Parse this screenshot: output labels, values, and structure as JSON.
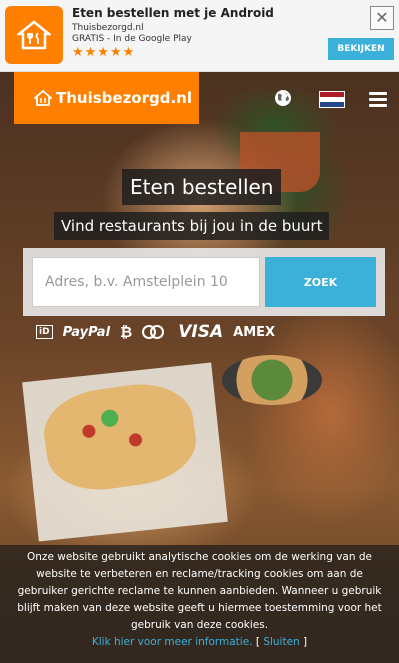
{
  "app_banner": {
    "title": "Eten bestellen met je Android",
    "developer": "Thuisbezorgd.nl",
    "store_info": "GRATIS - In de Google Play",
    "stars": "★★★★★",
    "rating": 5,
    "close_symbol": "✕",
    "view_label": "BEKIJKEN",
    "icon": "fork-knife-icon"
  },
  "header": {
    "logo_text": "Thuisbezorgd.nl",
    "icons": [
      "house-fork-icon",
      "globe-icon",
      "nl-flag-icon",
      "hamburger-menu-icon"
    ]
  },
  "hero": {
    "title": "Eten bestellen",
    "subtitle": "Vind restaurants bij jou in de buurt"
  },
  "search": {
    "placeholder": "Adres, b.v. Amstelplein 10",
    "value": "",
    "button_label": "ZOEK"
  },
  "payments": {
    "ideal": "iD",
    "paypal": "PayPal",
    "bitcoin": "₿",
    "visa": "VISA",
    "amex": "AMEX"
  },
  "cookie": {
    "text": "Onze website gebruikt analytische cookies om de werking van de website te verbeteren en reclame/tracking cookies om aan de gebruiker gerichte reclame te kunnen aanbieden. Wanneer u gebruik blijft maken van deze website geeft u hiermee toestemming voor het gebruik van deze cookies.",
    "more_info_link": "Klik hier voor meer informatie.",
    "bracket_open": "[",
    "close_link": "Sluiten",
    "bracket_close": "]"
  },
  "colors": {
    "brand_orange": "#ff8000",
    "accent_blue": "#3bb0d8",
    "flag_red": "#ae1c28",
    "flag_white": "#ffffff",
    "flag_blue": "#21468b"
  }
}
